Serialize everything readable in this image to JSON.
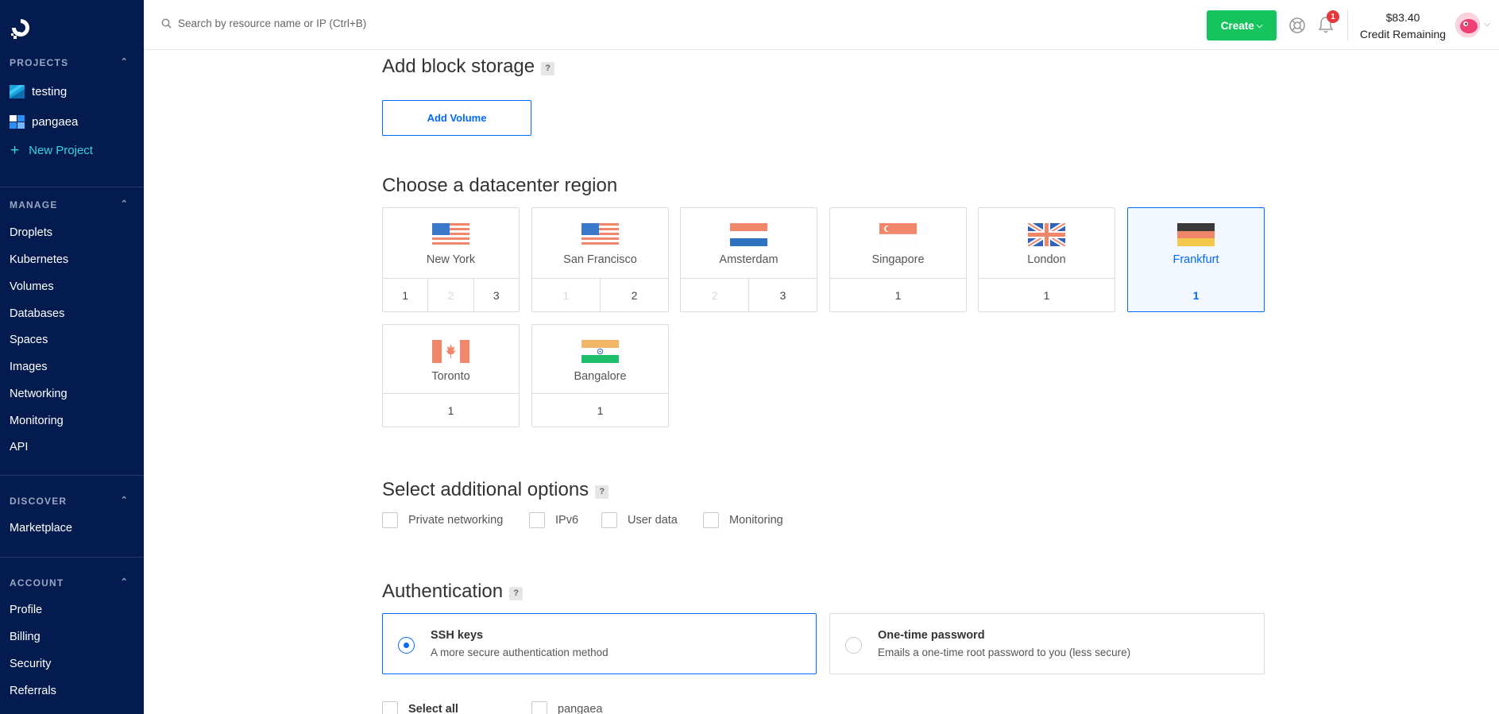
{
  "sidebar": {
    "projects_header": "PROJECTS",
    "projects": [
      {
        "label": "testing"
      },
      {
        "label": "pangaea"
      }
    ],
    "new_project": "New Project",
    "manage_header": "MANAGE",
    "manage_items": [
      "Droplets",
      "Kubernetes",
      "Volumes",
      "Databases",
      "Spaces",
      "Images",
      "Networking",
      "Monitoring",
      "API"
    ],
    "discover_header": "DISCOVER",
    "discover_items": [
      "Marketplace"
    ],
    "account_header": "ACCOUNT",
    "account_items": [
      "Profile",
      "Billing",
      "Security",
      "Referrals"
    ]
  },
  "topbar": {
    "search_placeholder": "Search by resource name or IP (Ctrl+B)",
    "create_label": "Create",
    "notification_count": "1",
    "credit_amount": "$83.40",
    "credit_label": "Credit Remaining"
  },
  "block_storage": {
    "title": "Add block storage",
    "help": "?",
    "add_volume": "Add Volume"
  },
  "region": {
    "title": "Choose a datacenter region",
    "regions": [
      {
        "name": "New York",
        "flag": "us-flag",
        "dcs": [
          "1",
          "2",
          "3"
        ]
      },
      {
        "name": "San Francisco",
        "flag": "us-flag",
        "dcs": [
          "1",
          "2"
        ]
      },
      {
        "name": "Amsterdam",
        "flag": "nl-flag",
        "dcs": [
          "2",
          "3"
        ]
      },
      {
        "name": "Singapore",
        "flag": "sg-flag",
        "dcs": [
          "1"
        ]
      },
      {
        "name": "London",
        "flag": "uk-flag",
        "dcs": [
          "1"
        ]
      },
      {
        "name": "Frankfurt",
        "flag": "de-flag",
        "dcs": [
          "1"
        ]
      },
      {
        "name": "Toronto",
        "flag": "ca-flag",
        "dcs": [
          "1"
        ]
      },
      {
        "name": "Bangalore",
        "flag": "in-flag",
        "dcs": [
          "1"
        ]
      }
    ]
  },
  "options": {
    "title": "Select additional options",
    "help": "?",
    "items": [
      "Private networking",
      "IPv6",
      "User data",
      "Monitoring"
    ]
  },
  "auth": {
    "title": "Authentication",
    "help": "?",
    "ssh_title": "SSH keys",
    "ssh_desc": "A more secure authentication method",
    "otp_title": "One-time password",
    "otp_desc": "Emails a one-time root password to you (less secure)",
    "select_all": "Select all",
    "key_name": "pangaea"
  },
  "colors": {
    "sidebar_bg": "#031b4e",
    "accent": "#0069ff",
    "create_green": "#15c45c",
    "new_project_cyan": "#2fd6e4"
  }
}
